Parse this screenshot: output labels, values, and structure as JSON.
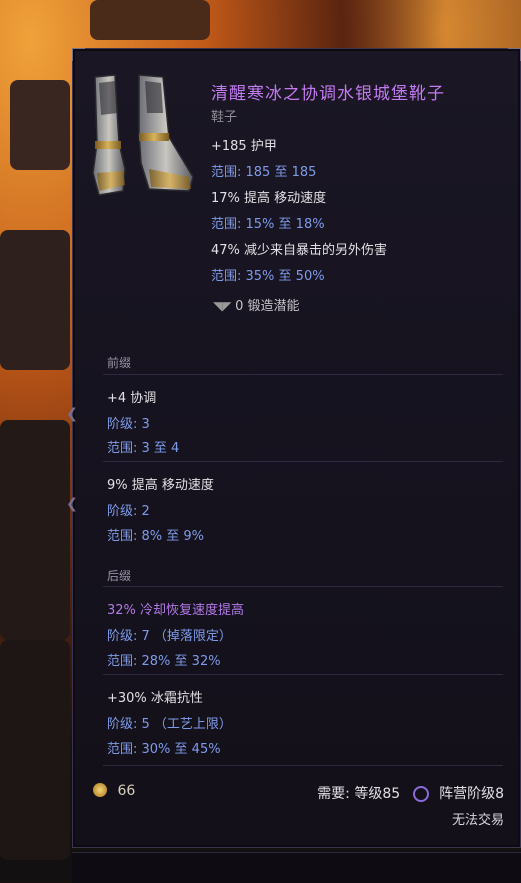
{
  "item": {
    "name": "清醒寒冰之协调水银城堡靴子",
    "type": "鞋子",
    "implicits": [
      {
        "stat": "+185 护甲",
        "range": "范围: 185 至 185"
      },
      {
        "stat": "17% 提高 移动速度",
        "range": "范围: 15% 至 18%"
      },
      {
        "stat": "47% 减少来自暴击的另外伤害",
        "range": "范围: 35% 至 50%"
      }
    ],
    "forge_potential": "0 锻造潜能"
  },
  "prefix_section": {
    "label": "前缀",
    "affixes": [
      {
        "name": "+4 协调",
        "tier": "阶级: 3",
        "range": "范围: 3 至 4"
      },
      {
        "name": "9% 提高 移动速度",
        "tier": "阶级: 2",
        "range": "范围: 8% 至 9%"
      }
    ]
  },
  "suffix_section": {
    "label": "后缀",
    "affixes": [
      {
        "name": "32% 冷却恢复速度提高",
        "tier": "阶级: 7 （掉落限定）",
        "range": "范围: 28% 至 32%"
      },
      {
        "name": "+30% 冰霜抗性",
        "tier": "阶级: 5 （工艺上限）",
        "range": "范围: 30% 至 45%"
      }
    ]
  },
  "footer": {
    "gold_value": "66",
    "requirement_level": "需要: 等级85",
    "faction_rank": "阵营阶级8",
    "trade_status": "无法交易"
  },
  "colors": {
    "item_name": "#c27bf0",
    "range_text": "#7f9be8",
    "panel_bg": "#15121e"
  }
}
